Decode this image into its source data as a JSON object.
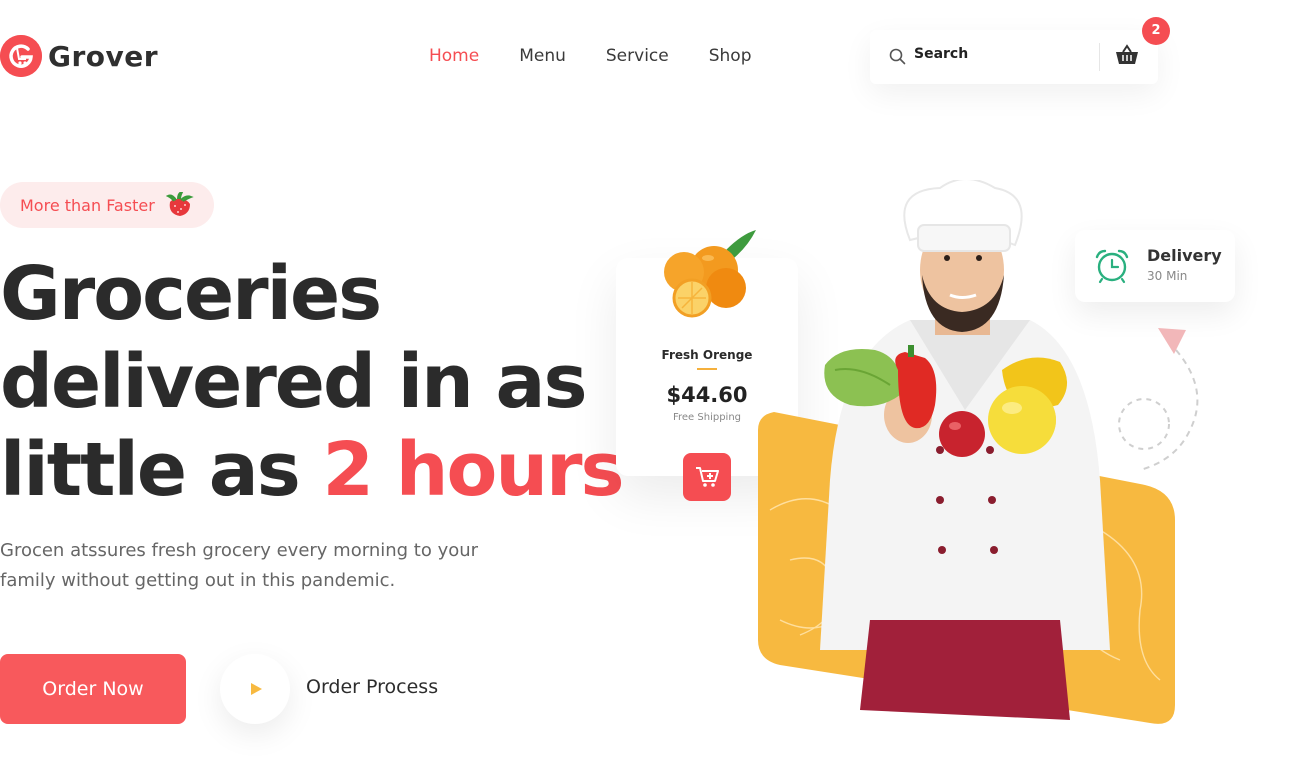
{
  "brand": {
    "name": "Grover",
    "accent_color": "#f54d52"
  },
  "nav": {
    "items": [
      {
        "label": "Home",
        "active": true
      },
      {
        "label": "Menu",
        "active": false
      },
      {
        "label": "Service",
        "active": false
      },
      {
        "label": "Shop",
        "active": false
      }
    ]
  },
  "search": {
    "placeholder": "Search",
    "icon": "search-icon"
  },
  "cart": {
    "count": "2",
    "icon": "basket-icon"
  },
  "hero": {
    "tagline": "More than Faster",
    "tagline_icon": "strawberry-icon",
    "headline_line1": "Groceries",
    "headline_line2": "delivered in as",
    "headline_line3_prefix": "little as ",
    "headline_highlight": "2 hours",
    "description": "Grocen atssures fresh grocery every morning to your family without getting out in this pandemic.",
    "primary_button": "Order Now",
    "secondary_label": "Order Process"
  },
  "product": {
    "name": "Fresh Orenge",
    "price": "$44.60",
    "shipping": "Free Shipping",
    "icon": "add-to-cart-icon"
  },
  "delivery": {
    "title": "Delivery",
    "time": "30 Min",
    "icon": "alarm-clock-icon"
  },
  "colors": {
    "primary": "#f54d52",
    "yellow": "#f7b940",
    "text_dark": "#2b2b2b",
    "text_muted": "#666666"
  }
}
